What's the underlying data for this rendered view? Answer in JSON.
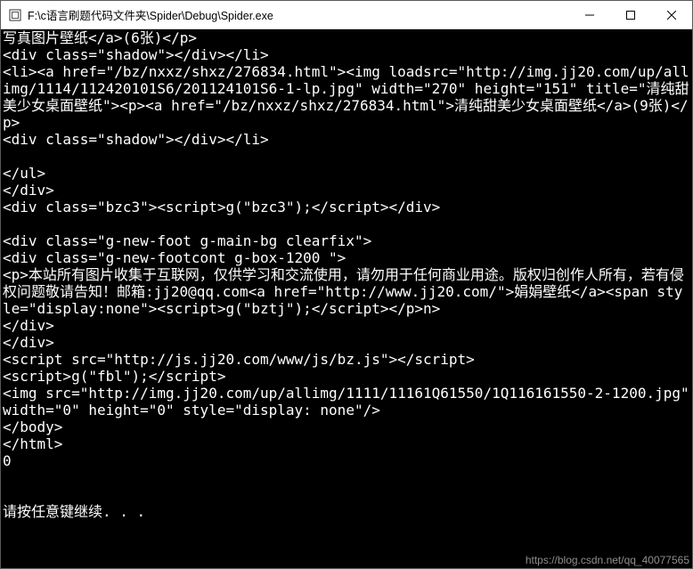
{
  "window": {
    "title": "F:\\c语言刷题代码文件夹\\Spider\\Debug\\Spider.exe",
    "icon_name": "app-icon"
  },
  "controls": {
    "minimize": "minimize",
    "maximize": "maximize",
    "close": "close"
  },
  "console_lines": [
    "写真图片壁纸</a>(6张)</p>",
    "<div class=\"shadow\"></div></li>",
    "<li><a href=\"/bz/nxxz/shxz/276834.html\"><img loadsrc=\"http://img.jj20.com/up/allimg/1114/112420101S6/201124101S6-1-lp.jpg\" width=\"270\" height=\"151\" title=\"清纯甜美少女桌面壁纸\"><p><a href=\"/bz/nxxz/shxz/276834.html\">清纯甜美少女桌面壁纸</a>(9张)</p>",
    "<div class=\"shadow\"></div></li>",
    "",
    "</ul>",
    "</div>",
    "<div class=\"bzc3\"><script>g(\"bzc3\");</script></div>",
    "",
    "<div class=\"g-new-foot g-main-bg clearfix\">",
    "<div class=\"g-new-footcont g-box-1200 \">",
    "<p>本站所有图片收集于互联网，仅供学习和交流使用，请勿用于任何商业用途。版权归创作人所有，若有侵权问题敬请告知！邮箱:jj20@qq.com<a href=\"http://www.jj20.com/\">娟娟壁纸</a><span style=\"display:none\"><script>g(\"bztj\");</script></p>n>",
    "</div>",
    "</div>",
    "<script src=\"http://js.jj20.com/www/js/bz.js\"></script>",
    "<script>g(\"fbl\");</script>",
    "<img src=\"http://img.jj20.com/up/allimg/1111/11161Q61550/1Q116161550-2-1200.jpg\" width=\"0\" height=\"0\" style=\"display: none\"/>",
    "</body>",
    "</html>",
    "0",
    "",
    "",
    "请按任意键继续. . ."
  ],
  "watermark": "https://blog.csdn.net/qq_40077565"
}
